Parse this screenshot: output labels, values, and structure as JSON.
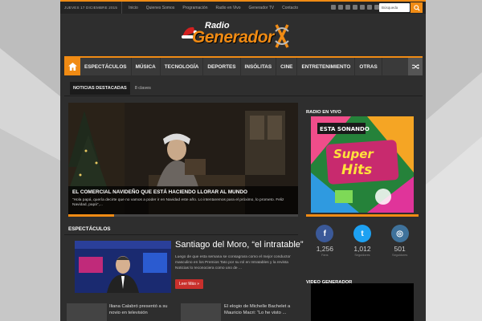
{
  "topbar": {
    "date": "JUEVES 17 DICIEMBRE 2015",
    "links": [
      "Inicio",
      "Quienes Somos",
      "Programación",
      "Radio en Vivo",
      "Generador TV",
      "Contacto"
    ],
    "search_placeholder": "Búsqueda"
  },
  "logo": {
    "line1": "Radio",
    "line2": "Generador"
  },
  "nav": {
    "items": [
      "ESPECTÁCULOS",
      "MÚSICA",
      "TECNOLOGÍA",
      "DEPORTES",
      "INSÓLITAS",
      "CINE",
      "ENTRETENIMIENTO",
      "OTRAS"
    ]
  },
  "breaking": {
    "label": "NOTICIAS DESTACADAS",
    "text": "8 claves"
  },
  "slider": {
    "title": "EL COMERCIAL NAVIDEÑO QUE ESTÁ HACIENDO LLORAR AL MUNDO",
    "excerpt": "“Hola papá, quería decirte que no vamos a poder ir en Navidad este año. Lo intentaremos para el próximo, lo prometo. Feliz Navidad, papá”,...",
    "progress": 0.2
  },
  "section": {
    "title": "ESPECTÁCULOS",
    "post_title": "Santiago del Moro, “el intratable”",
    "post_excerpt": "Luego de que esta semana se consagrara como el mejor conductor masculino en los Premios Tato por su rol en Intratables y la revista Noticias lo reconociera como uno de ...",
    "read_more": "Leer Más »",
    "mini1": "Iliana Calabró presentó a su novio en televisión",
    "mini2": "El elogio de Michelle Bachelet a Mauricio Macri: “Lo he visto ..."
  },
  "sidebar": {
    "radio_title": "RADIO EN VIVO",
    "social": [
      {
        "icon": "f",
        "count": "1,256",
        "label": "Fans",
        "color": "#3b5998"
      },
      {
        "icon": "t",
        "count": "1,012",
        "label": "Seguidores",
        "color": "#1da1f2"
      },
      {
        "icon": "◎",
        "count": "501",
        "label": "Seguidores",
        "color": "#3f729b"
      }
    ],
    "video_title": "VIDEO GENERADOR"
  },
  "colors": {
    "accent": "#f08b14",
    "background": "#2e2e2e",
    "read_more": "#c9302c"
  }
}
